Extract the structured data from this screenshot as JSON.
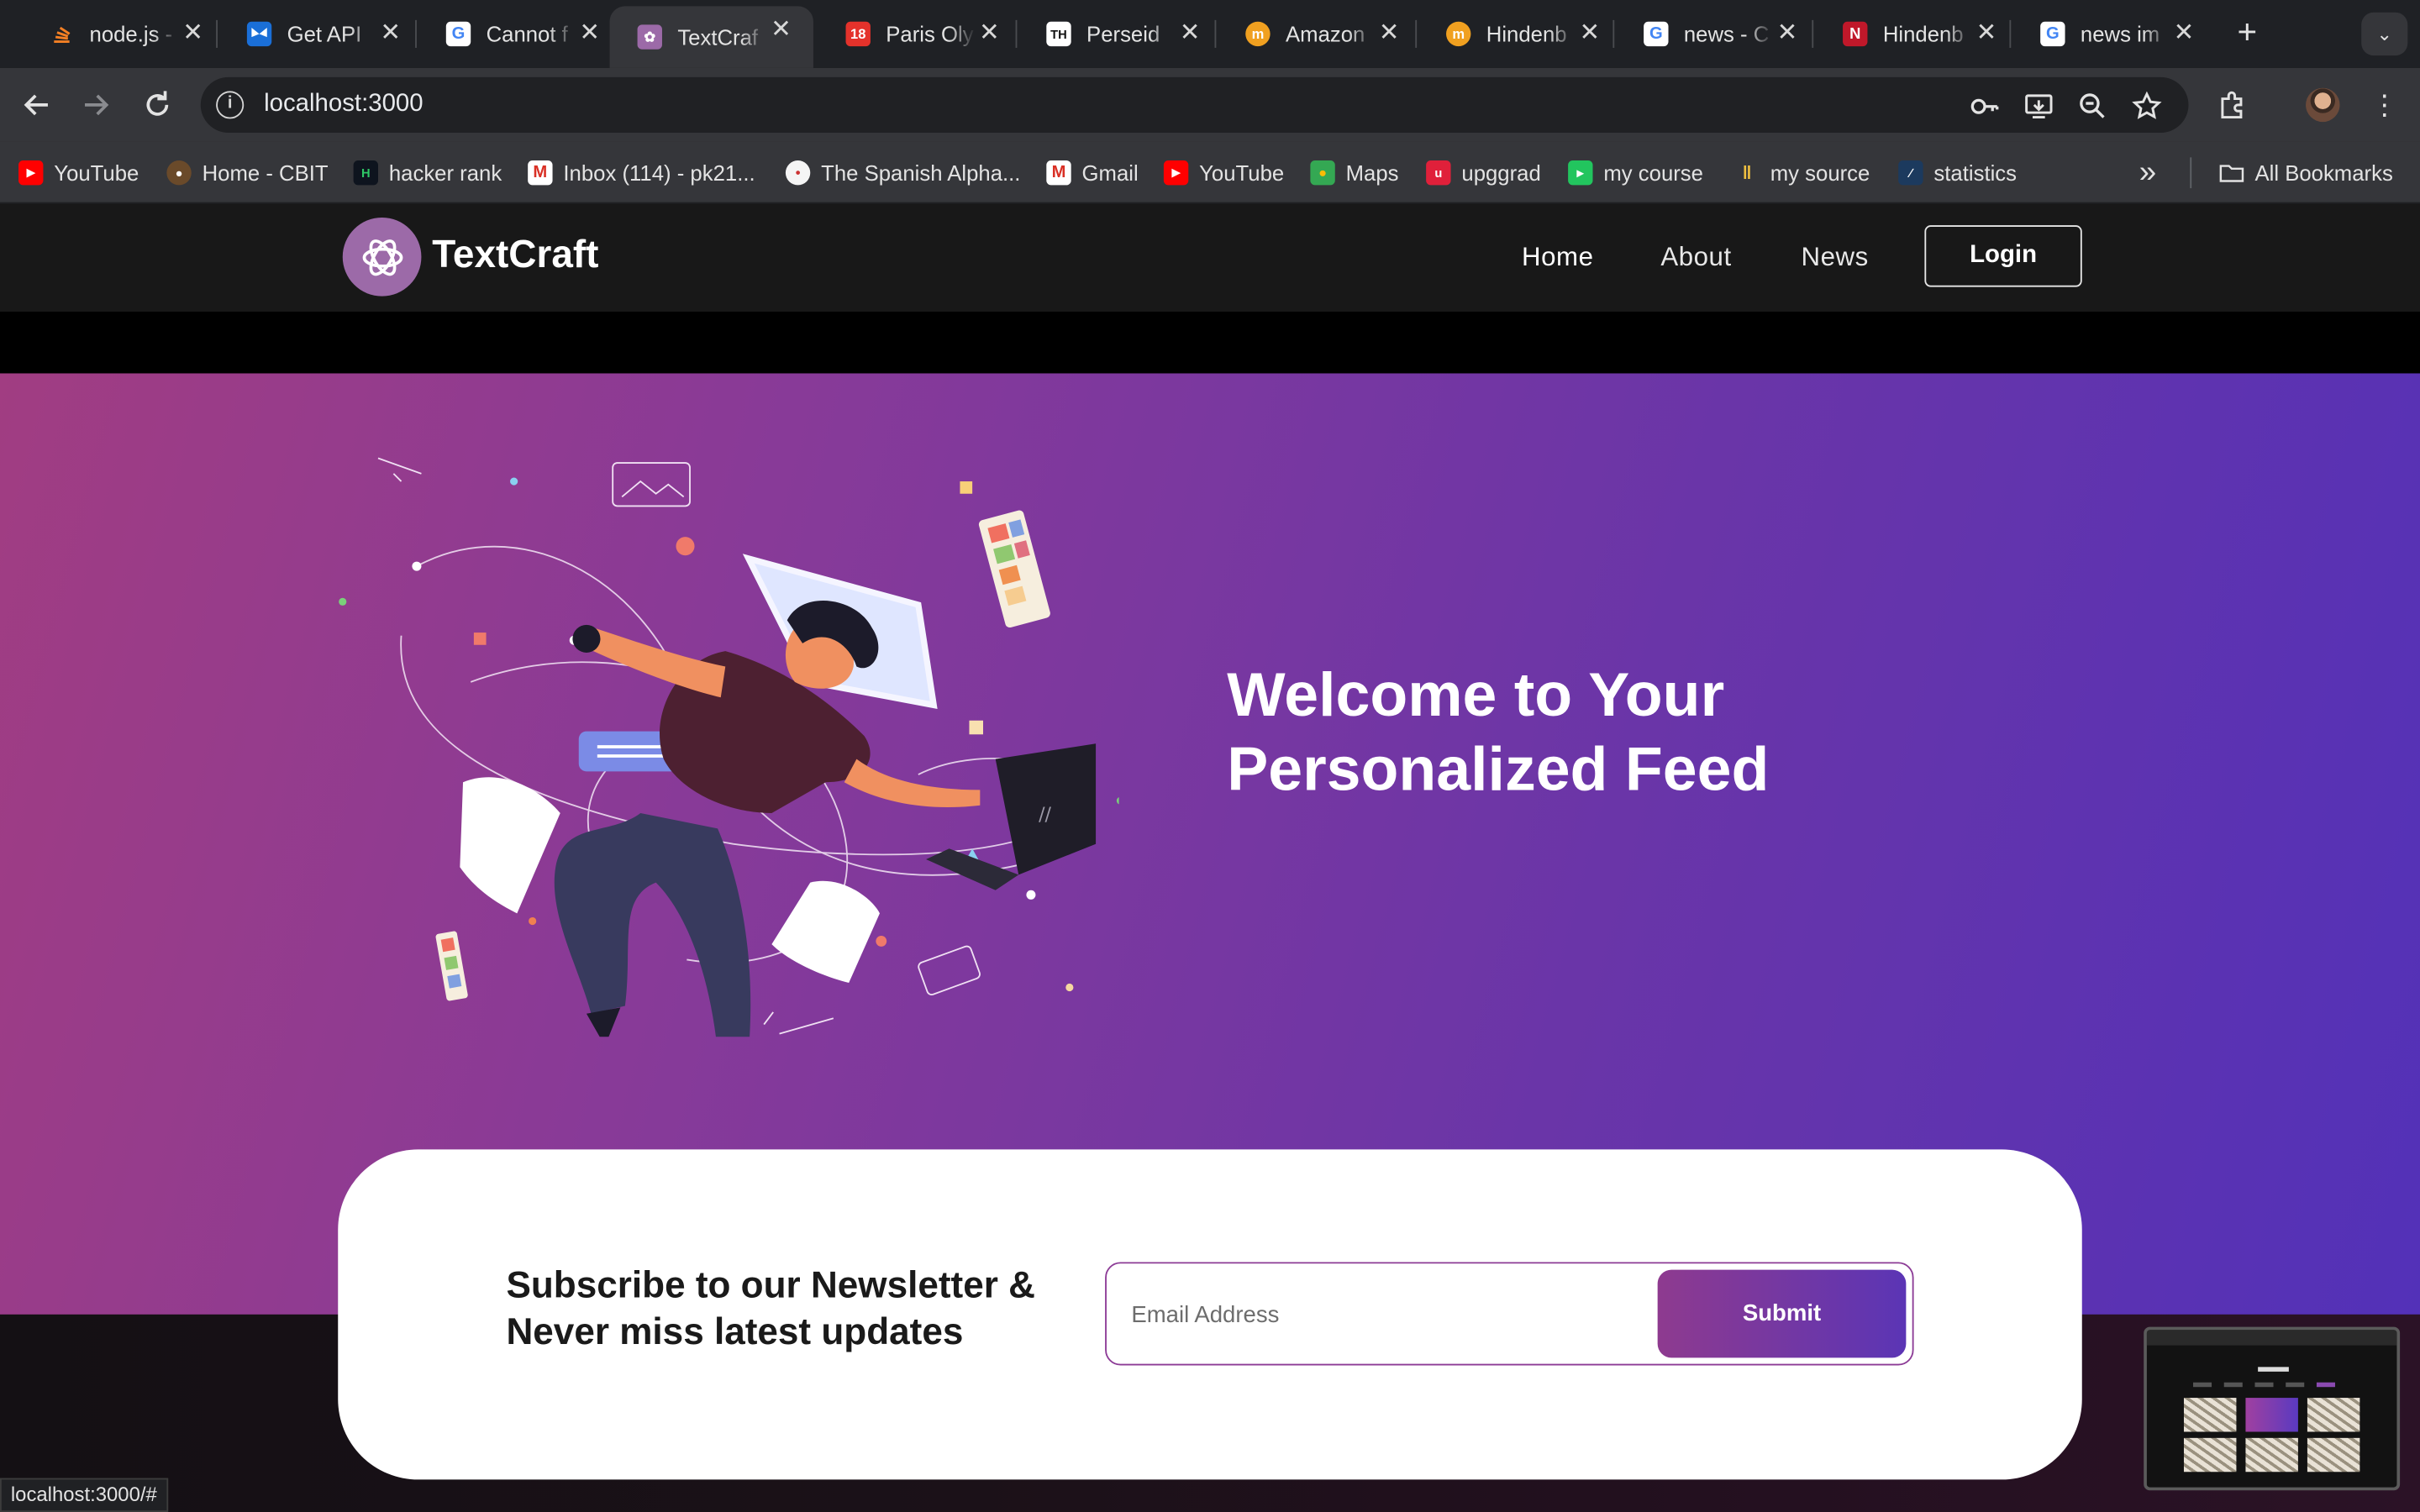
{
  "browser": {
    "tabs": [
      {
        "label": "node.js -",
        "favicon": "stack-icon",
        "active": false
      },
      {
        "label": "Get API",
        "favicon": "butterfly-icon",
        "active": false
      },
      {
        "label": "Cannot f",
        "favicon": "google-icon",
        "active": false
      },
      {
        "label": "TextCraf",
        "favicon": "openai-icon",
        "active": true
      },
      {
        "label": "Paris Oly",
        "favicon": "news18-icon",
        "active": false
      },
      {
        "label": "Perseid",
        "favicon": "th-icon",
        "active": false
      },
      {
        "label": "Amazon",
        "favicon": "moneycontrol-icon",
        "active": false
      },
      {
        "label": "Hindenb",
        "favicon": "moneycontrol-icon",
        "active": false
      },
      {
        "label": "news - C",
        "favicon": "google-icon",
        "active": false
      },
      {
        "label": "Hindenb",
        "favicon": "ndtv-icon",
        "active": false
      },
      {
        "label": "news im",
        "favicon": "google-icon",
        "active": false
      }
    ],
    "url": "localhost:3000",
    "bookmarks": [
      {
        "label": "YouTube",
        "icon": "youtube-icon"
      },
      {
        "label": "Home - CBIT",
        "icon": "cbit-icon"
      },
      {
        "label": "hacker rank",
        "icon": "hackerrank-icon"
      },
      {
        "label": "Inbox (114) - pk21...",
        "icon": "gmail-icon"
      },
      {
        "label": "The Spanish Alpha...",
        "icon": "speech-icon"
      },
      {
        "label": "Gmail",
        "icon": "gmail-icon"
      },
      {
        "label": "YouTube",
        "icon": "youtube-icon"
      },
      {
        "label": "Maps",
        "icon": "maps-icon"
      },
      {
        "label": "upggrad",
        "icon": "upgrad-icon"
      },
      {
        "label": "my course",
        "icon": "course-icon"
      },
      {
        "label": "my source",
        "icon": "source-icon"
      },
      {
        "label": "statistics",
        "icon": "stats-icon"
      }
    ],
    "all_bookmarks": "All Bookmarks",
    "status_url": "localhost:3000/#"
  },
  "site": {
    "brand": "TextCraft",
    "nav": {
      "home": "Home",
      "about": "About",
      "news": "News",
      "login": "Login"
    },
    "hero": {
      "title": "Welcome to Your Personalized Feed"
    },
    "newsletter": {
      "title": "Subscribe to our Newsletter & Never miss latest updates",
      "placeholder": "Email Address",
      "submit": "Submit"
    }
  },
  "colors": {
    "hero_start": "#a13d82",
    "hero_end": "#5331b8",
    "accent": "#8c3b96"
  }
}
